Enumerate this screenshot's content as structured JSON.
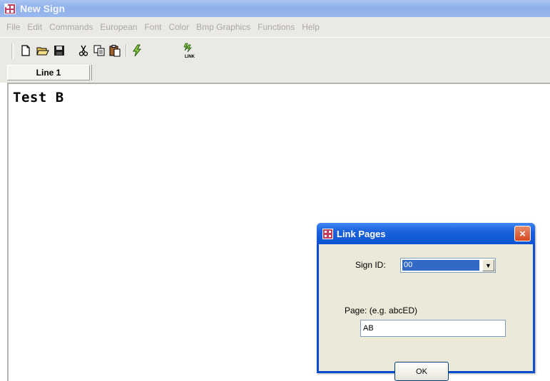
{
  "window": {
    "title": "New Sign",
    "icon": "app-sign-icon"
  },
  "menu": [
    "File",
    "Edit",
    "Commands",
    "European",
    "Font",
    "Color",
    "Bmp Graphics",
    "Functions",
    "Help"
  ],
  "toolbar": {
    "buttons": [
      "new-file-icon",
      "open-folder-icon",
      "save-disk-icon",
      "cut-scissors-icon",
      "copy-icon",
      "paste-icon",
      "lightning-icon",
      "link-pages-icon"
    ],
    "link_label": "LINK"
  },
  "tabs": [
    {
      "label": "Line 1"
    }
  ],
  "editor": {
    "text": "Test B"
  },
  "dialog": {
    "title": "Link Pages",
    "close_glyph": "×",
    "sign_id_label": "Sign ID:",
    "sign_id_value": "00",
    "dropdown_glyph": "▼",
    "page_label": "Page: (e.g. abcED)",
    "page_value": "AB",
    "ok_label": "OK"
  },
  "colors": {
    "title_bar": "#9ab8ee",
    "dialog_frame": "#0b4fcf",
    "selection": "#316ac5",
    "close_button": "#d3471f"
  }
}
